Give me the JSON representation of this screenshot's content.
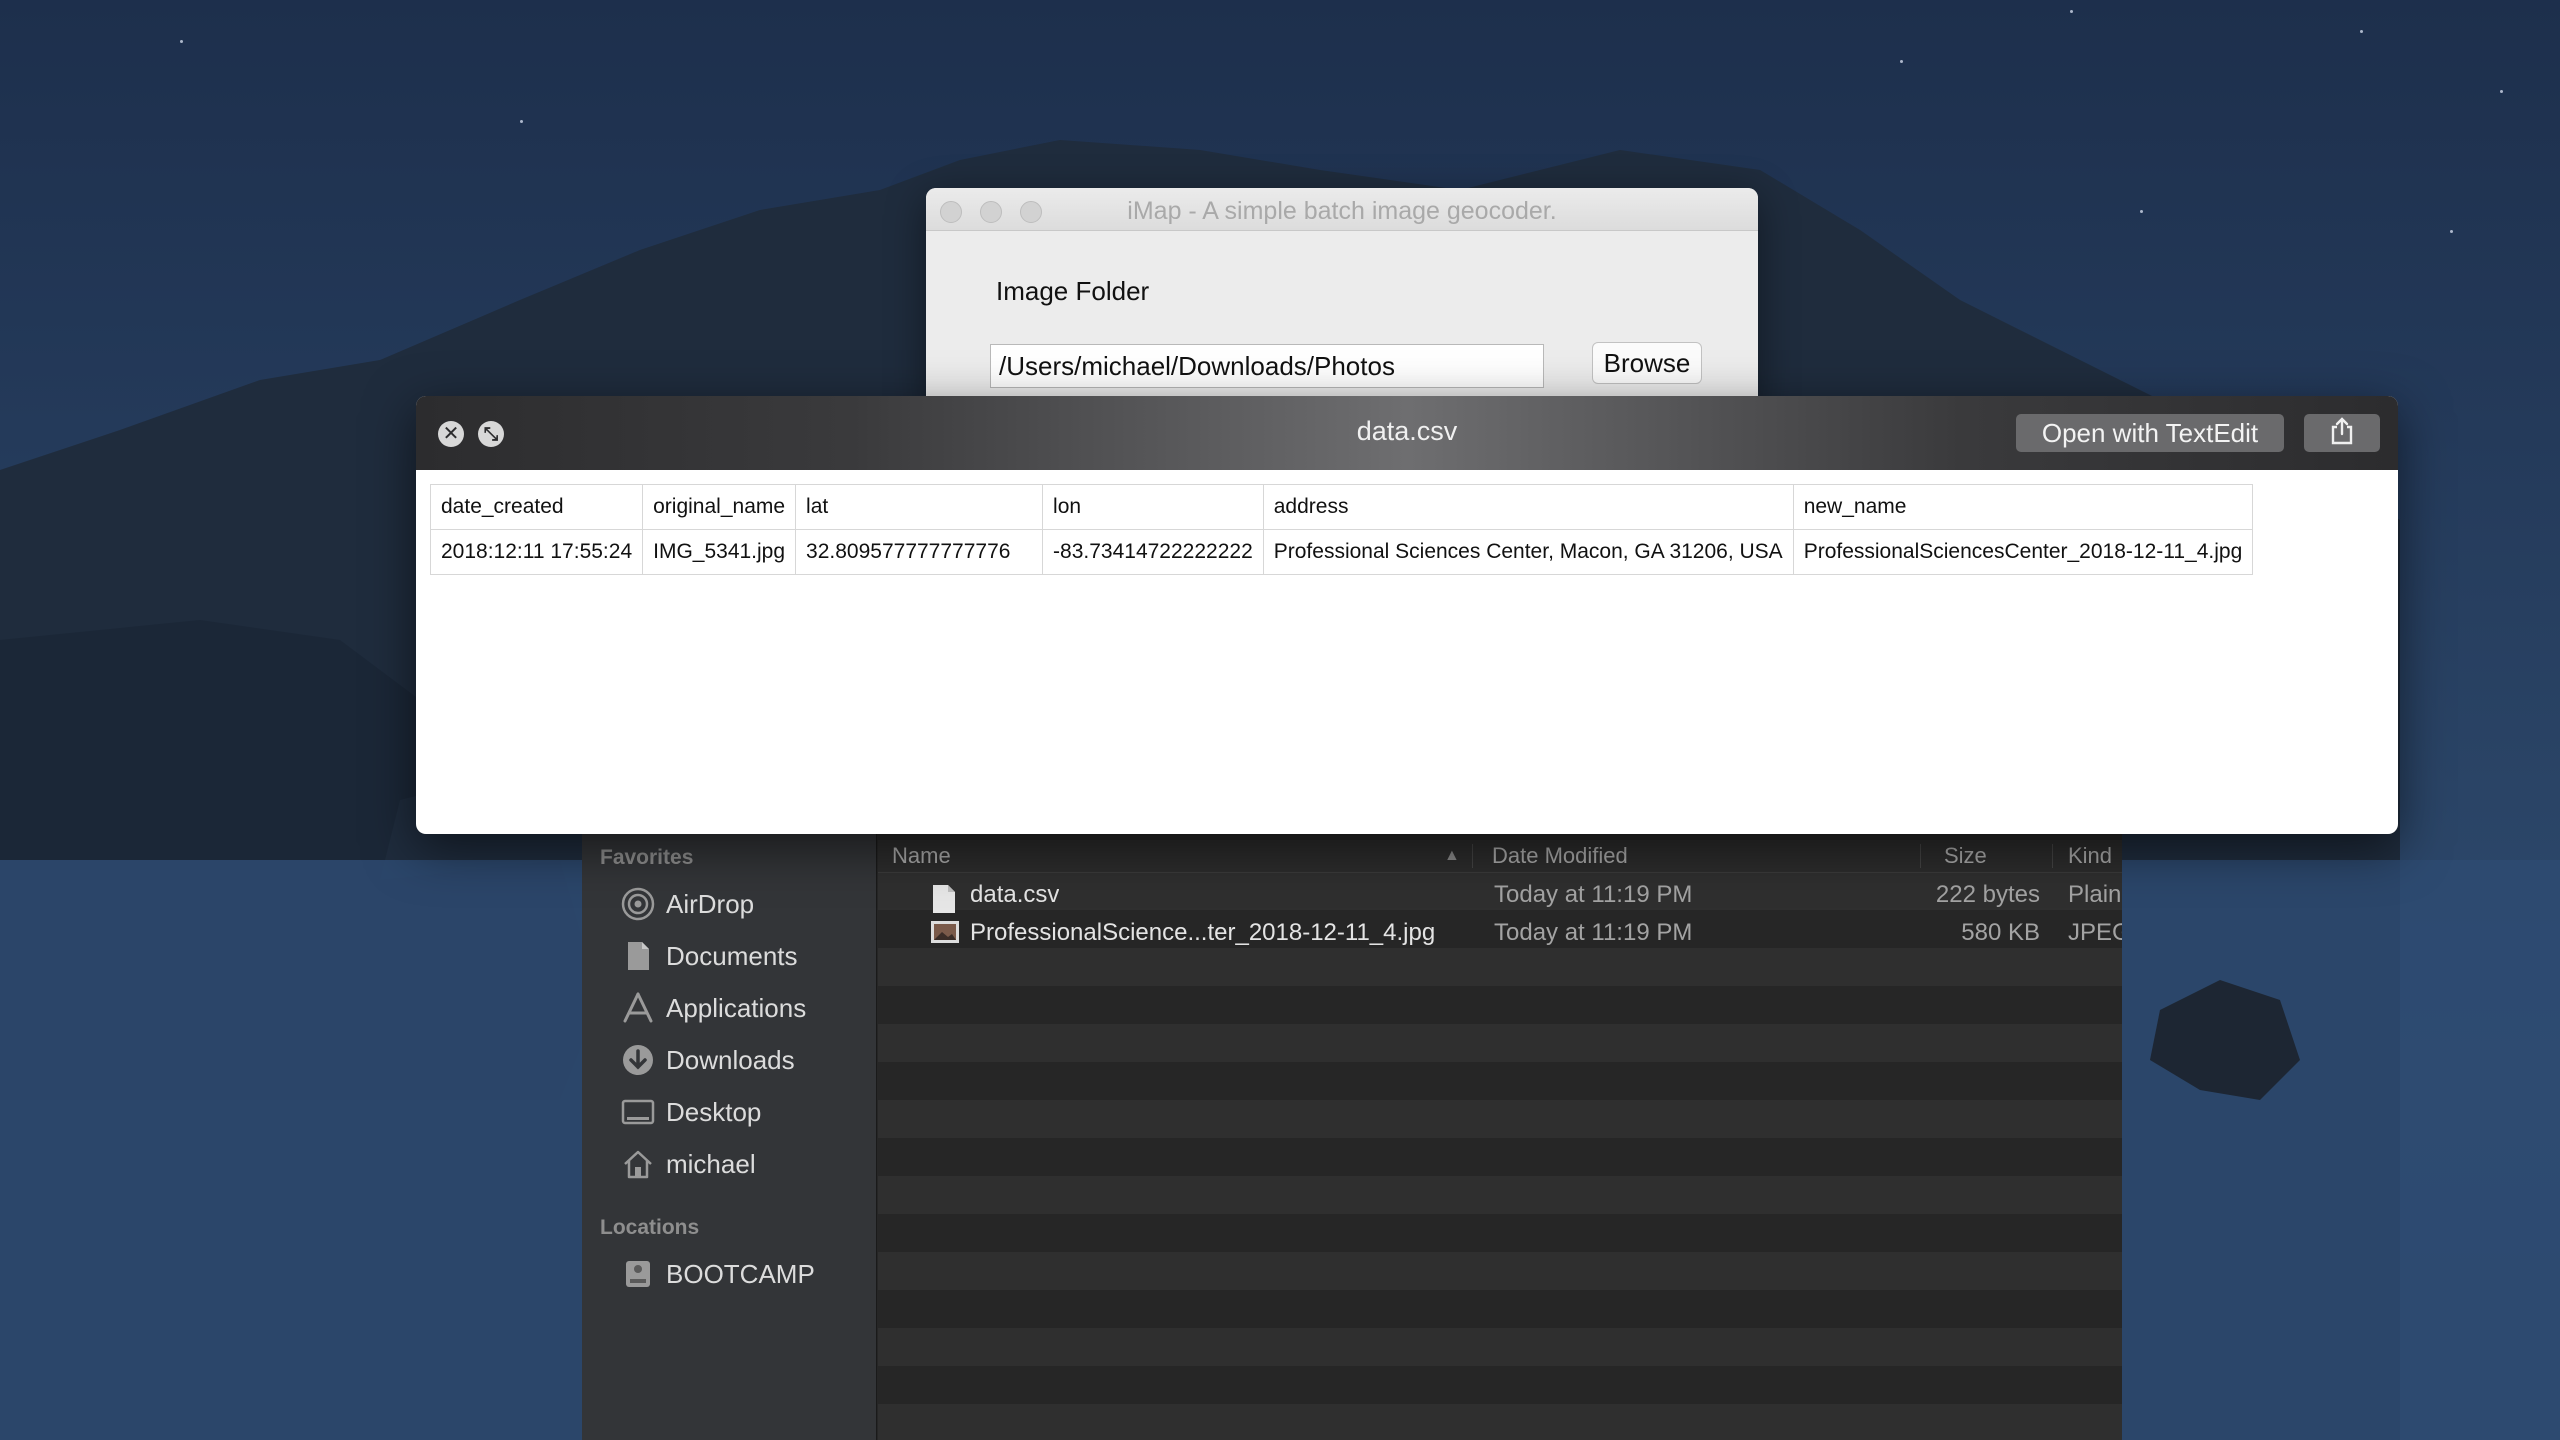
{
  "imap": {
    "title": "iMap - A simple batch image geocoder.",
    "image_folder_label": "Image Folder",
    "folder_path": "/Users/michael/Downloads/Photos",
    "browse_label": "Browse"
  },
  "quicklook": {
    "title": "data.csv",
    "open_with_label": "Open with TextEdit",
    "close_icon": "close-circle-icon",
    "fullscreen_icon": "fullscreen-circle-icon",
    "share_icon": "share-icon",
    "table": {
      "headers": [
        "date_created",
        "original_name",
        "lat",
        "lon",
        "address",
        "new_name"
      ],
      "rows": [
        [
          "2018:12:11 17:55:24",
          "IMG_5341.jpg",
          "32.809577777777776",
          "-83.73414722222222",
          "Professional Sciences Center, Macon, GA 31206, USA",
          "ProfessionalSciencesCenter_2018-12-11_4.jpg"
        ]
      ]
    }
  },
  "finder": {
    "sidebar": {
      "favorites_heading": "Favorites",
      "favorites": [
        {
          "label": "AirDrop",
          "icon": "airdrop-icon"
        },
        {
          "label": "Documents",
          "icon": "documents-icon"
        },
        {
          "label": "Applications",
          "icon": "applications-icon"
        },
        {
          "label": "Downloads",
          "icon": "downloads-icon"
        },
        {
          "label": "Desktop",
          "icon": "desktop-icon"
        },
        {
          "label": "michael",
          "icon": "home-icon"
        }
      ],
      "locations_heading": "Locations",
      "locations": [
        {
          "label": "BOOTCAMP",
          "icon": "disk-icon"
        }
      ]
    },
    "columns": {
      "name": "Name",
      "date_modified": "Date Modified",
      "size": "Size",
      "kind": "Kind"
    },
    "files": [
      {
        "name": "data.csv",
        "date_modified": "Today at 11:19 PM",
        "size": "222 bytes",
        "kind": "Plain T",
        "icon": "text-file-icon"
      },
      {
        "name": "ProfessionalScience...ter_2018-12-11_4.jpg",
        "date_modified": "Today at 11:19 PM",
        "size": "580 KB",
        "kind": "JPEG i",
        "icon": "image-file-icon"
      }
    ]
  },
  "colors": {
    "desktop_bg": "#243a5a",
    "finder_bg": "#262626",
    "sidebar_bg": "#333538",
    "quicklook_bar": "#3a3a3c"
  }
}
